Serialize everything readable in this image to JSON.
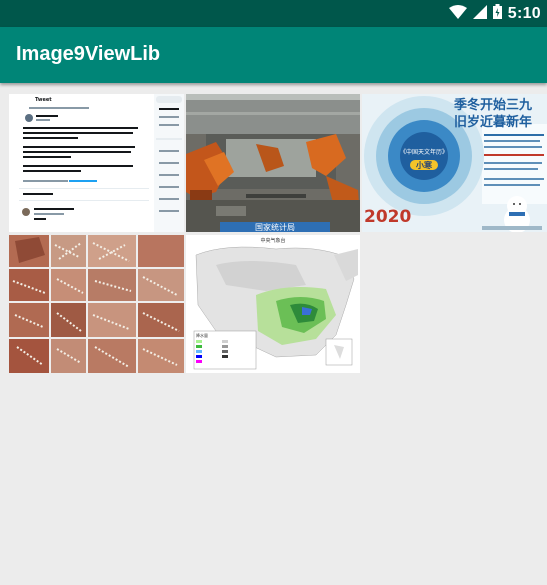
{
  "status_bar": {
    "time": "5:10",
    "icons": [
      "wifi-icon",
      "cell-signal-icon",
      "battery-icon"
    ]
  },
  "app_bar": {
    "title": "Image9ViewLib"
  },
  "colors": {
    "status_bar": "#00574b",
    "app_bar": "#008577",
    "background": "#ececec"
  },
  "images": [
    {
      "name": "tweet-screenshot-thumbnail",
      "text": {
        "header": "Tweet",
        "sidebar": "Trends for you",
        "body": "As 5th & final REMEDIAL step under paragraph 36 of JCPOA. Iran will no longer be any restriction on number of centrifuges"
      }
    },
    {
      "name": "factory-robots-thumbnail",
      "text": {
        "caption": "国家统计局"
      }
    },
    {
      "name": "xiaohan-solar-term-poster-thumbnail",
      "text": {
        "headline_1": "季冬开始三九",
        "headline_2": "旧岁近暮新年",
        "center": "小寒",
        "year": "2020"
      }
    },
    {
      "name": "rock-art-collage-thumbnail",
      "text": {}
    },
    {
      "name": "precipitation-map-thumbnail",
      "text": {
        "title": "中央气象台",
        "legend": "降水量"
      }
    }
  ]
}
